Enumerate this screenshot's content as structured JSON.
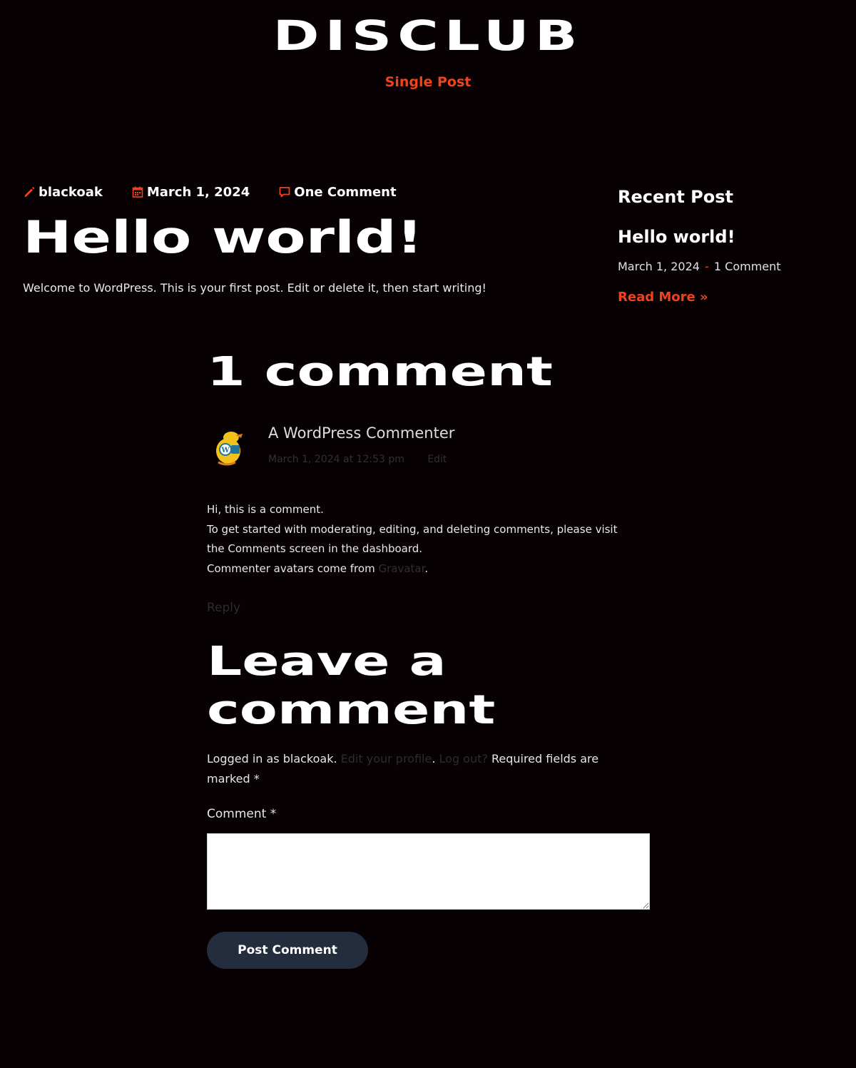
{
  "header": {
    "site_title": "DISCLUB",
    "page_subtitle": "Single Post"
  },
  "post": {
    "author": "blackoak",
    "date": "March 1, 2024",
    "comments_link": "One Comment",
    "title": "Hello world!",
    "content": "Welcome to WordPress. This is your first post. Edit or delete it, then start writing!"
  },
  "sidebar": {
    "heading": "Recent Post",
    "recent_title": "Hello world!",
    "recent_date": "March 1, 2024",
    "recent_separator": "-",
    "recent_comments": "1 Comment",
    "read_more": "Read More »"
  },
  "comments": {
    "title": "1 comment",
    "items": [
      {
        "author": "A WordPress Commenter",
        "datetime": "March 1, 2024 at 12:53 pm",
        "edit_label": "Edit",
        "line1": "Hi, this is a comment.",
        "line2": "To get started with moderating, editing, and deleting comments, please visit the Comments screen in the dashboard.",
        "line3_prefix": "Commenter avatars come from",
        "line3_link": "Gravatar",
        "line3_suffix": ".",
        "reply_label": "Reply"
      }
    ]
  },
  "reply_form": {
    "title": "Leave a comment",
    "logged_in_prefix": "Logged in as blackoak.",
    "edit_profile": "Edit your profile",
    "period": ".",
    "log_out": "Log out?",
    "required_note": "Required fields are marked *",
    "comment_label": "Comment *",
    "comment_value": "",
    "submit_label": "Post Comment"
  },
  "colors": {
    "background": "#070103",
    "accent": "#f0431c",
    "button": "#232d3d",
    "muted_link": "#2b2b30"
  }
}
